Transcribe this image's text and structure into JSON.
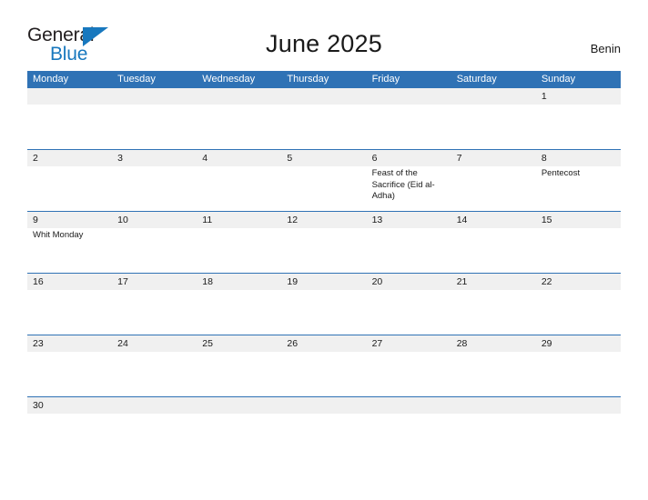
{
  "brand": {
    "name_part1": "General",
    "name_part2": "Blue",
    "mark": "blue-triangle-flag",
    "color_dark": "#231f20",
    "color_blue": "#1878be"
  },
  "header": {
    "title": "June 2025",
    "region": "Benin"
  },
  "colors": {
    "header_blue": "#2f72b5",
    "row_band_gray": "#f0f0f0",
    "text": "#1a1a1a",
    "page_background": "#ffffff"
  },
  "calendar": {
    "month": "June",
    "year": "2025",
    "weekday_headers": [
      "Monday",
      "Tuesday",
      "Wednesday",
      "Thursday",
      "Friday",
      "Saturday",
      "Sunday"
    ],
    "weeks": [
      {
        "days": [
          {
            "num": "",
            "events": []
          },
          {
            "num": "",
            "events": []
          },
          {
            "num": "",
            "events": []
          },
          {
            "num": "",
            "events": []
          },
          {
            "num": "",
            "events": []
          },
          {
            "num": "",
            "events": []
          },
          {
            "num": "1",
            "events": []
          }
        ]
      },
      {
        "days": [
          {
            "num": "2",
            "events": []
          },
          {
            "num": "3",
            "events": []
          },
          {
            "num": "4",
            "events": []
          },
          {
            "num": "5",
            "events": []
          },
          {
            "num": "6",
            "events": [
              "Feast of the Sacrifice (Eid al-Adha)"
            ]
          },
          {
            "num": "7",
            "events": []
          },
          {
            "num": "8",
            "events": [
              "Pentecost"
            ]
          }
        ]
      },
      {
        "days": [
          {
            "num": "9",
            "events": [
              "Whit Monday"
            ]
          },
          {
            "num": "10",
            "events": []
          },
          {
            "num": "11",
            "events": []
          },
          {
            "num": "12",
            "events": []
          },
          {
            "num": "13",
            "events": []
          },
          {
            "num": "14",
            "events": []
          },
          {
            "num": "15",
            "events": []
          }
        ]
      },
      {
        "days": [
          {
            "num": "16",
            "events": []
          },
          {
            "num": "17",
            "events": []
          },
          {
            "num": "18",
            "events": []
          },
          {
            "num": "19",
            "events": []
          },
          {
            "num": "20",
            "events": []
          },
          {
            "num": "21",
            "events": []
          },
          {
            "num": "22",
            "events": []
          }
        ]
      },
      {
        "days": [
          {
            "num": "23",
            "events": []
          },
          {
            "num": "24",
            "events": []
          },
          {
            "num": "25",
            "events": []
          },
          {
            "num": "26",
            "events": []
          },
          {
            "num": "27",
            "events": []
          },
          {
            "num": "28",
            "events": []
          },
          {
            "num": "29",
            "events": []
          }
        ]
      },
      {
        "days": [
          {
            "num": "30",
            "events": []
          },
          {
            "num": "",
            "events": []
          },
          {
            "num": "",
            "events": []
          },
          {
            "num": "",
            "events": []
          },
          {
            "num": "",
            "events": []
          },
          {
            "num": "",
            "events": []
          },
          {
            "num": "",
            "events": []
          }
        ]
      }
    ]
  }
}
